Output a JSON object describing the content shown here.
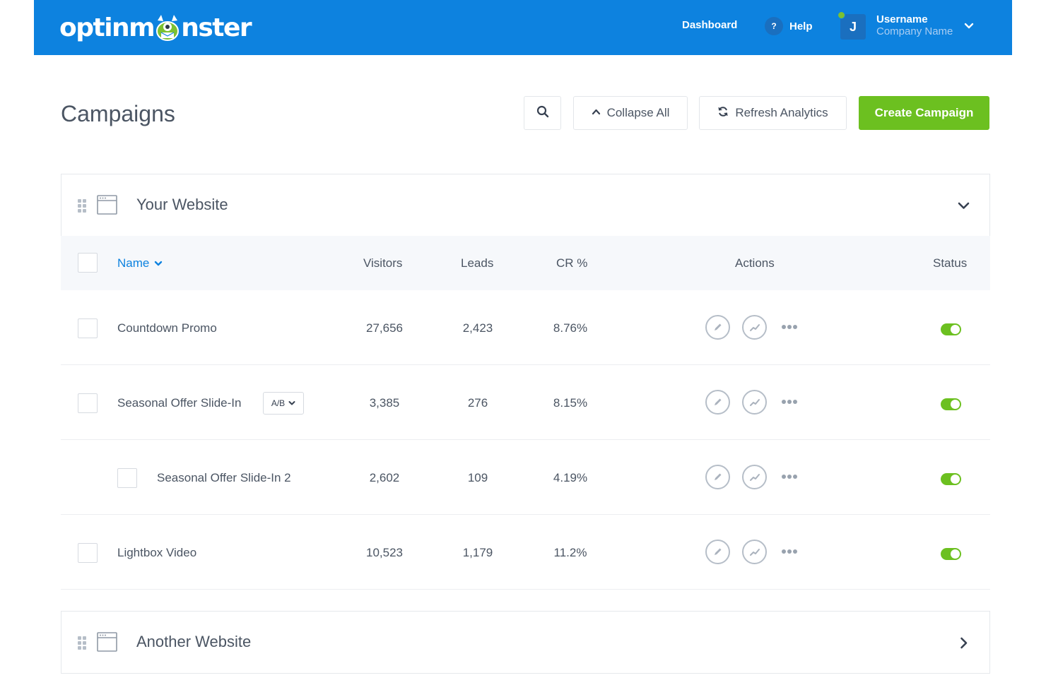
{
  "app": {
    "logo_text": "optinmonster"
  },
  "topbar": {
    "nav_dashboard": "Dashboard",
    "help_icon_label": "?",
    "nav_help": "Help",
    "avatar_initial": "J",
    "user_name": "Username",
    "company_name": "Company Name",
    "online_status_color": "#7cc131"
  },
  "page": {
    "title": "Campaigns",
    "collapse_all_label": "Collapse All",
    "refresh_label": "Refresh Analytics",
    "create_label": "Create Campaign"
  },
  "sites": [
    {
      "name": "Your Website",
      "expanded": true,
      "columns": {
        "name": "Name",
        "visitors": "Visitors",
        "leads": "Leads",
        "cr": "CR %",
        "actions": "Actions",
        "status": "Status"
      },
      "campaigns": [
        {
          "name": "Countdown Promo",
          "visitors": "27,656",
          "leads": "2,423",
          "cr": "8.76%",
          "status_on": true
        },
        {
          "name": "Seasonal Offer Slide-In",
          "badge": "A/B",
          "visitors": "3,385",
          "leads": "276",
          "cr": "8.15%",
          "status_on": true
        },
        {
          "name": "Seasonal Offer Slide-In 2",
          "visitors": "2,602",
          "leads": "109",
          "cr": "4.19%",
          "status_on": true,
          "child": true
        },
        {
          "name": "Lightbox Video",
          "visitors": "10,523",
          "leads": "1,179",
          "cr": "11.2%",
          "status_on": true
        }
      ]
    },
    {
      "name": "Another Website",
      "expanded": false
    }
  ],
  "colors": {
    "brand_blue": "#0d82df",
    "accent_green": "#6cc020",
    "text": "#4b5563"
  }
}
